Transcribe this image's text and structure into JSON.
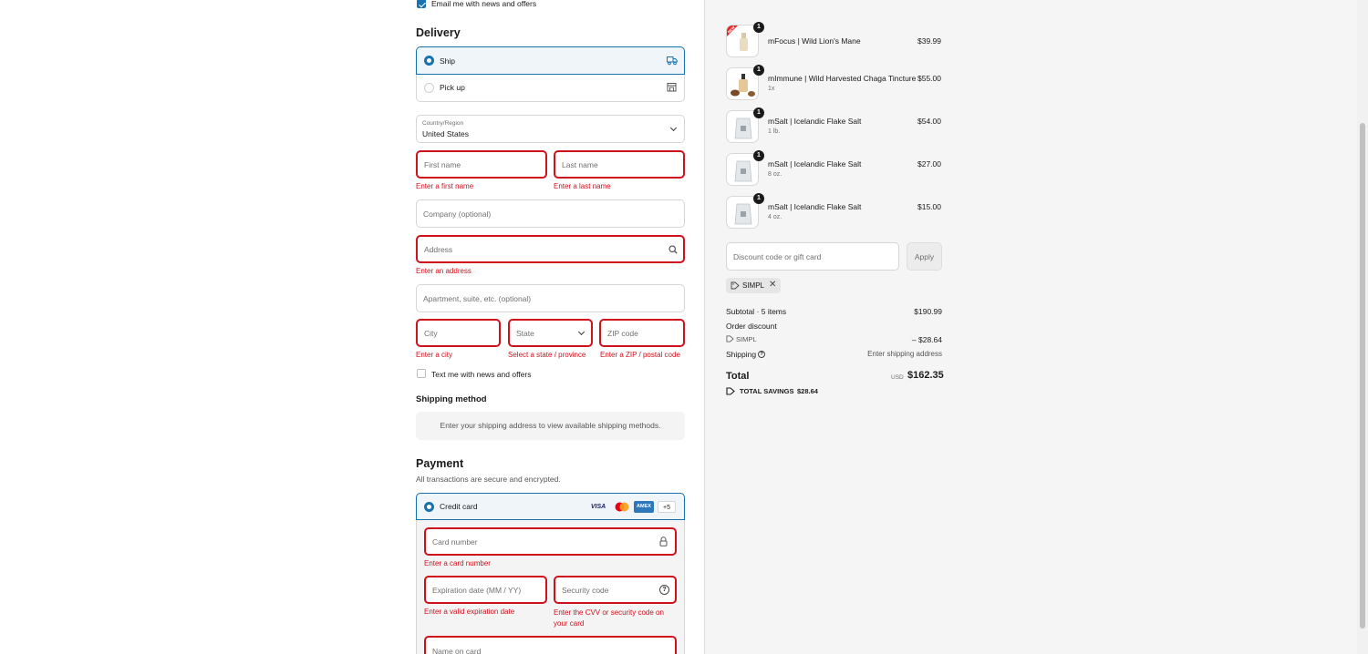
{
  "contact": {
    "email_news_label": "Email me with news and offers",
    "email_news_checked": true
  },
  "delivery": {
    "heading": "Delivery",
    "options": [
      {
        "label": "Ship",
        "selected": true,
        "icon": "truck-icon"
      },
      {
        "label": "Pick up",
        "selected": false,
        "icon": "store-icon"
      }
    ],
    "country_label": "Country/Region",
    "country_value": "United States",
    "first_name_placeholder": "First name",
    "first_name_error": "Enter a first name",
    "last_name_placeholder": "Last name",
    "last_name_error": "Enter a last name",
    "company_placeholder": "Company (optional)",
    "address_placeholder": "Address",
    "address_error": "Enter an address",
    "apartment_placeholder": "Apartment, suite, etc. (optional)",
    "city_placeholder": "City",
    "city_error": "Enter a city",
    "state_placeholder": "State",
    "state_error": "Select a state / province",
    "zip_placeholder": "ZIP code",
    "zip_error": "Enter a ZIP / postal code",
    "text_news_label": "Text me with news and offers",
    "text_news_checked": false
  },
  "shipping_method": {
    "heading": "Shipping method",
    "message": "Enter your shipping address to view available shipping methods."
  },
  "payment": {
    "heading": "Payment",
    "subheading": "All transactions are secure and encrypted.",
    "method_label": "Credit card",
    "card_brands": [
      "VISA",
      "mastercard",
      "AMEX",
      "+5"
    ],
    "card_number_placeholder": "Card number",
    "card_number_error": "Enter a card number",
    "expiry_placeholder": "Expiration date (MM / YY)",
    "expiry_error": "Enter a valid expiration date",
    "security_placeholder": "Security code",
    "security_error": "Enter the CVV or security code on your card",
    "name_placeholder": "Name on card"
  },
  "order": {
    "items": [
      {
        "name": "mFocus | Wild Lion's Mane",
        "variant": "",
        "price": "$39.99",
        "qty": "1",
        "badge": "NEW"
      },
      {
        "name": "mImmune | Wild Harvested Chaga Tincture",
        "variant": "1x",
        "price": "$55.00",
        "qty": "1"
      },
      {
        "name": "mSalt | Icelandic Flake Salt",
        "variant": "1 lb.",
        "price": "$54.00",
        "qty": "1"
      },
      {
        "name": "mSalt | Icelandic Flake Salt",
        "variant": "8 oz.",
        "price": "$27.00",
        "qty": "1"
      },
      {
        "name": "mSalt | Icelandic Flake Salt",
        "variant": "4 oz.",
        "price": "$15.00",
        "qty": "1"
      }
    ],
    "discount_placeholder": "Discount code or gift card",
    "apply_label": "Apply",
    "applied_code": "SIMPL",
    "subtotal_label": "Subtotal · 5 items",
    "subtotal_value": "$190.99",
    "order_discount_label": "Order discount",
    "discount_code": "SIMPL",
    "discount_value": "– $28.64",
    "shipping_label": "Shipping",
    "shipping_value": "Enter shipping address",
    "total_label": "Total",
    "currency": "USD",
    "total_value": "$162.35",
    "savings_label": "TOTAL SAVINGS",
    "savings_value": "$28.64"
  },
  "colors": {
    "accent": "#1773b0",
    "error": "#d0111c",
    "panel": "#f5f5f5"
  }
}
